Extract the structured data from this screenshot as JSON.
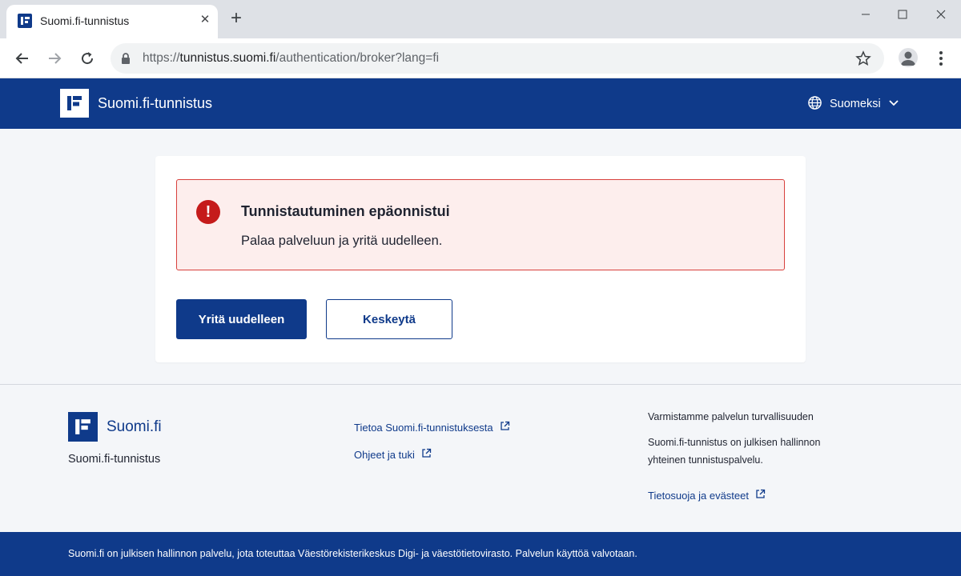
{
  "browser": {
    "tab_title": "Suomi.fi-tunnistus",
    "url_scheme": "https://",
    "url_host": "tunnistus.suomi.fi",
    "url_path": "/authentication/broker?lang=fi"
  },
  "header": {
    "title": "Suomi.fi-tunnistus",
    "language": "Suomeksi"
  },
  "alert": {
    "title": "Tunnistautuminen epäonnistui",
    "text": "Palaa palveluun ja yritä uudelleen."
  },
  "actions": {
    "retry_label": "Yritä uudelleen",
    "cancel_label": "Keskeytä"
  },
  "footer": {
    "brand": "Suomi.fi",
    "subtitle": "Suomi.fi-tunnistus",
    "links": [
      {
        "label": "Tietoa Suomi.fi-tunnistuksesta"
      },
      {
        "label": "Ohjeet ja tuki"
      }
    ],
    "security_heading": "Varmistamme palvelun turvallisuuden",
    "security_text_1": "Suomi.fi-tunnistus on julkisen hallinnon",
    "security_text_2": "yhteinen tunnistuspalvelu.",
    "privacy_link": "Tietosuoja ja evästeet",
    "bottom_text": "Suomi.fi on julkisen hallinnon palvelu, jota toteuttaa Väestörekisterikeskus Digi- ja väestötietovirasto. Palvelun käyttöä valvotaan."
  },
  "colors": {
    "brand_blue": "#0f3a8a",
    "error_red": "#c51b1b",
    "alert_bg": "#fdeeed"
  }
}
